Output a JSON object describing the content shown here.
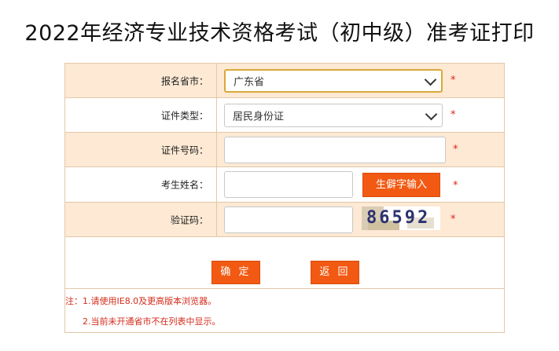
{
  "page": {
    "title": "2022年经济专业技术资格考试（初中级）准考证打印"
  },
  "form": {
    "province": {
      "label": "报名省市：",
      "selected": "广东省"
    },
    "id_type": {
      "label": "证件类型：",
      "selected": "居民身份证"
    },
    "id_number": {
      "label": "证件号码：",
      "value": ""
    },
    "name": {
      "label": "考生姓名：",
      "value": "",
      "rare_char_button": "生僻字输入"
    },
    "captcha": {
      "label": "验证码：",
      "value": "",
      "image_text": "86592"
    },
    "required_mark": "*"
  },
  "actions": {
    "confirm": "确 定",
    "back": "返 回"
  },
  "notes": {
    "line1": "注：1.请使用IE8.0及更高版本浏览器。",
    "line2": "2.当前未开通省市不在列表中显示。"
  },
  "colors": {
    "accent": "#f25a13",
    "row_highlight": "#fde9d4",
    "required": "#e0251d",
    "border": "#e3c8a9"
  }
}
